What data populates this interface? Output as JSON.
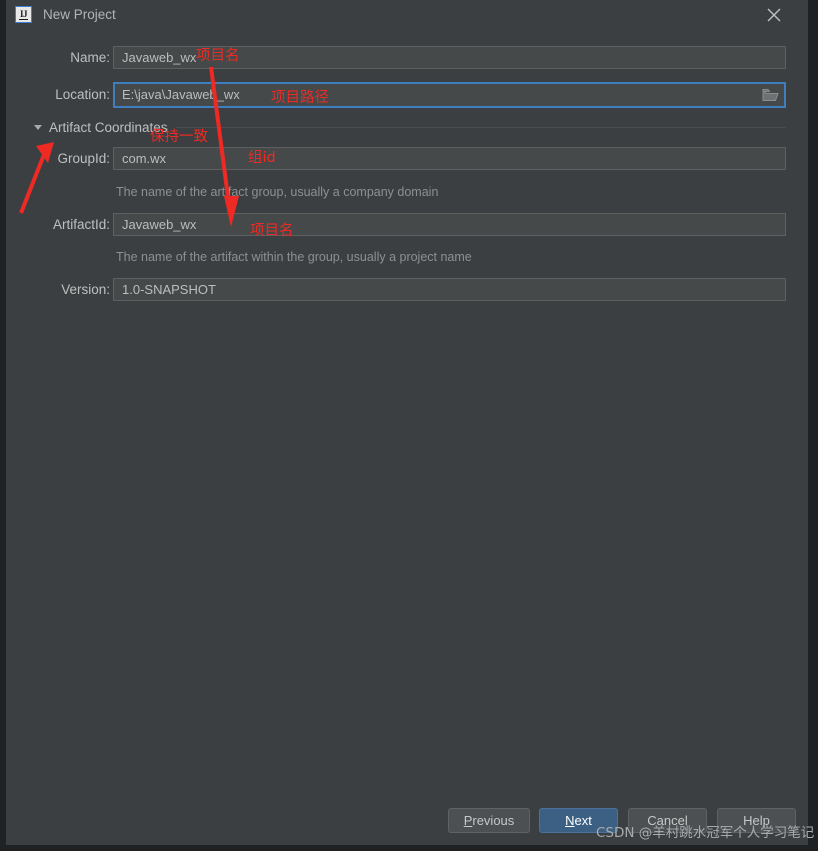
{
  "window": {
    "title": "New Project",
    "app_icon": "intellij-idea-icon",
    "close_icon": "close-icon",
    "background_color": "#3c3f41",
    "accent_color": "#3c6083"
  },
  "form": {
    "name": {
      "label": "Name:",
      "value": "Javaweb_wx",
      "placeholder": ""
    },
    "location": {
      "label": "Location:",
      "value": "E:\\java\\Javaweb_wx",
      "placeholder": "",
      "browse_icon": "folder-open-icon",
      "focused": true
    },
    "artifact_section": {
      "label": "Artifact Coordinates",
      "expanded": true,
      "toggle_icon": "chevron-down-icon"
    },
    "group_id": {
      "label": "GroupId:",
      "value": "com.wx",
      "hint": "The name of the artifact group, usually a company domain"
    },
    "artifact_id": {
      "label": "ArtifactId:",
      "value": "Javaweb_wx",
      "hint": "The name of the artifact within the group, usually a project name"
    },
    "version": {
      "label": "Version:",
      "value": "1.0-SNAPSHOT"
    }
  },
  "buttons": {
    "previous": "Previous",
    "previous_mnemonic": "P",
    "next": "Next",
    "next_mnemonic": "N",
    "cancel": "Cancel",
    "help": "Help"
  },
  "annotations": {
    "color": "#ef2a24",
    "name_note": "项目名",
    "location_note": "项目路径",
    "consistent_note": "保持一致",
    "groupid_note": "组id",
    "artifactid_note": "项目名"
  },
  "watermark": {
    "text": "CSDN @羊村跳水冠军个人学习笔记"
  }
}
